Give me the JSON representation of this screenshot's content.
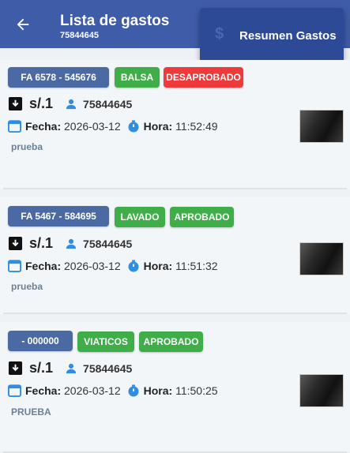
{
  "header": {
    "title": "Lista de gastos",
    "subtitle": "75844645",
    "summary_button": "Resumen Gastos",
    "summary_icon": "dollar-icon"
  },
  "colors": {
    "appbar": "#3f5ca8",
    "approved": "#3fae49",
    "rejected": "#ee3a3a",
    "code_badge": "#4b6aa3"
  },
  "expenses": [
    {
      "code": "FA 6578 - 545676",
      "category": "BALSA",
      "status": "DESAPROBADO",
      "amount": "s/.1",
      "user": "75844645",
      "date_label": "Fecha:",
      "date": "2026-03-12",
      "time_label": "Hora:",
      "time": "11:52:49",
      "description": "prueba"
    },
    {
      "code": "FA 5467 - 584695",
      "category": "LAVADO",
      "status": "APROBADO",
      "amount": "s/.1",
      "user": "75844645",
      "date_label": "Fecha:",
      "date": "2026-03-12",
      "time_label": "Hora:",
      "time": "11:51:32",
      "description": "prueba"
    },
    {
      "code": " - 000000",
      "category": "VIATICOS",
      "status": "APROBADO",
      "amount": "s/.1",
      "user": "75844645",
      "date_label": "Fecha:",
      "date": "2026-03-12",
      "time_label": "Hora:",
      "time": "11:50:25",
      "description": "PRUEBA"
    }
  ]
}
